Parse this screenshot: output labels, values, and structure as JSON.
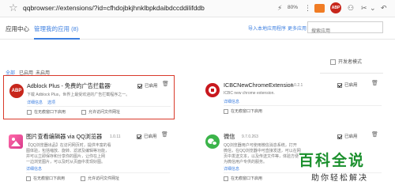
{
  "browser": {
    "url": "qqbrowser://extensions/?id=cfhdojbkjhnklbpkdaibdccddilifddb",
    "zoom": "80%",
    "abp_badge": "ABP"
  },
  "header": {
    "tab_app_center": "应用中心",
    "tab_manage": "管理我的应用",
    "manage_count": "(8)",
    "link_import": "导入本地应用程序",
    "link_more": "更多应用",
    "search_placeholder": "搜索应用"
  },
  "filters": {
    "all": "全部",
    "enabled": "已启用",
    "disabled": "未启用"
  },
  "dev_mode_label": "开发者模式",
  "extensions": [
    {
      "name": "Adblock Plus - 免费的广告拦截器",
      "version": "3.7",
      "desc": "下载 Adblock Plus，世界上最受欢迎的广告拦截程序之一。",
      "details": "详细信息",
      "options": "选项",
      "enabled_label": "已启用",
      "incognito": "在无痕窗口下启用",
      "file_access": "允许访问文件网址",
      "logo_text": "ABP"
    },
    {
      "name": "ICBCNewChromeExtension",
      "version": "1.0.2.1",
      "desc": "ICBC new chrome extension.",
      "details": "详细信息",
      "enabled_label": "已启用",
      "incognito": "在无痕窗口下启用"
    },
    {
      "name": "图片查看编辑器 via QQ浏览器",
      "version": "1.0.11",
      "desc_lines": [
        "【QQ浏览器出品】在访问网页时，提供丰富的看",
        "图体验，包括缩放、旋转、滤波及编辑等功能，",
        "并可以立即保存和分享你的图片，让你在上网",
        "一边浏览图片，可以及时从页面中发现好图。"
      ],
      "details": "详细信息",
      "enabled_label": "已启用",
      "incognito": "在无痕窗口下启用",
      "file_access": "允许访问文件网址"
    },
    {
      "name": "微信",
      "version": "9.7.0.263",
      "desc_lines": [
        "QQ浏览器用户可使用微信消息系统，打开",
        "微信，在QQ浏览器中可直接发送，可以在网",
        "页中发送文本，以及传送文件等，体验方便",
        "为微信用户专供的服务。"
      ],
      "details": "详细信息",
      "enabled_label": "已启用",
      "incognito": "在无痕窗口下启用"
    }
  ],
  "watermark": {
    "main": "百科全说",
    "sub": "助你轻松解决"
  }
}
